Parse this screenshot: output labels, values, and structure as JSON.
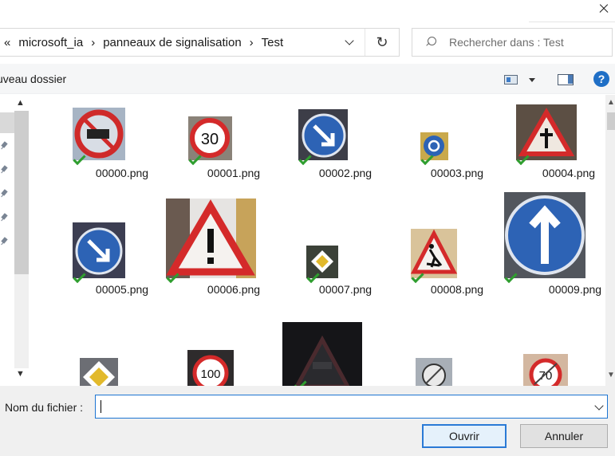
{
  "window": {
    "close_icon": "close-icon"
  },
  "address_bar": {
    "overflow_chevron": "«",
    "crumbs": [
      "microsoft_ia",
      "panneaux de signalisation",
      "Test"
    ],
    "separator": "›",
    "refresh_glyph": "↻"
  },
  "search": {
    "placeholder": "Rechercher dans : Test"
  },
  "toolbar": {
    "new_folder_label": "uveau dossier",
    "help_glyph": "?"
  },
  "files": [
    {
      "name": "00000.png",
      "sign": "no-trucks"
    },
    {
      "name": "00001.png",
      "sign": "speed-30"
    },
    {
      "name": "00002.png",
      "sign": "keep-right"
    },
    {
      "name": "00003.png",
      "sign": "roundabout"
    },
    {
      "name": "00004.png",
      "sign": "warning-crossroad"
    },
    {
      "name": "00005.png",
      "sign": "keep-right"
    },
    {
      "name": "00006.png",
      "sign": "general-caution"
    },
    {
      "name": "00007.png",
      "sign": "priority-road"
    },
    {
      "name": "00008.png",
      "sign": "road-work"
    },
    {
      "name": "00009.png",
      "sign": "ahead-only"
    },
    {
      "name": "",
      "sign": "priority-road"
    },
    {
      "name": "",
      "sign": "speed-100"
    },
    {
      "name": "",
      "sign": "warning-dark"
    },
    {
      "name": "",
      "sign": "end-restriction"
    },
    {
      "name": "",
      "sign": "speed-70"
    }
  ],
  "footer": {
    "filename_label": "Nom du fichier :",
    "filename_value": "",
    "open_label": "Ouvrir",
    "cancel_label": "Annuler"
  },
  "colors": {
    "accent": "#1d75d2",
    "check_green": "#2f9e2f",
    "sign_red": "#d42a2a",
    "sign_blue": "#2d63b5"
  }
}
